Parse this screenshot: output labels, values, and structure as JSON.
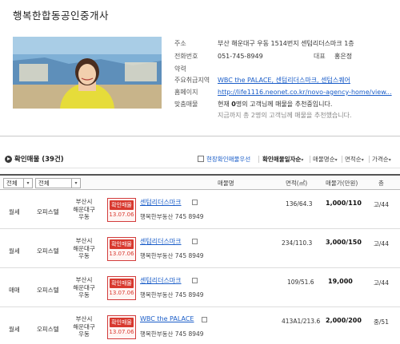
{
  "agency": {
    "name": "행복한합동공인중개사",
    "info": {
      "address_label": "주소",
      "address_value": "부산 해운대구 우동 1514번지 센텀리더스마크 1층",
      "phone_label": "전화번호",
      "phone_value": "051-745-8949",
      "rep_label": "대표",
      "rep_value": "홍은정",
      "brief_label": "약력",
      "region_label": "주요취급지역",
      "region_value": "WBC the PALACE, 센텀리더스마크, 센텀스퀘어",
      "homepage_label": "홈페이지",
      "homepage_value": "http://life1116.neonet.co.kr/novo-agency-home/view...",
      "custom_label": "맞춤매물",
      "custom_prefix": "현재 ",
      "custom_count": "0",
      "custom_suffix": "명의 고객님께 매물을 추천중입니다.",
      "custom_note": "지금까지 총 2명의 고객님께 매물을 추천했습니다."
    }
  },
  "section": {
    "title": "확인매물",
    "count": "(39건)"
  },
  "sort": {
    "items": [
      {
        "label": "현장확인매물우선"
      },
      {
        "label": "확인매물일자순"
      },
      {
        "label": "매물명순"
      },
      {
        "label": "면적순"
      },
      {
        "label": "가격순"
      }
    ],
    "arrow": "▾"
  },
  "list_header": {
    "filter1": "전체",
    "filter2": "전체",
    "col_name": "매물명",
    "col_area": "면적(㎡)",
    "col_price": "매물가(만원)",
    "col_floor": "층"
  },
  "stamp_label": "확인매물",
  "listings": [
    {
      "deal": "월세",
      "type": "오피스텔",
      "addr1": "부산시",
      "addr2": "해운대구",
      "addr3": "우동",
      "stamp_date": "13.07.06",
      "name": "센텀리더스마크",
      "agent": "행복한부동산 745 8949",
      "area": "136/64.3",
      "price": "1,000/110",
      "floor": "고/44"
    },
    {
      "deal": "월세",
      "type": "오피스텔",
      "addr1": "부산시",
      "addr2": "해운대구",
      "addr3": "우동",
      "stamp_date": "13.07.06",
      "name": "센텀리더스마크",
      "agent": "행복한부동산 745 8949",
      "area": "234/110.3",
      "price": "3,000/150",
      "floor": "고/44"
    },
    {
      "deal": "매매",
      "type": "오피스텔",
      "addr1": "부산시",
      "addr2": "해운대구",
      "addr3": "우동",
      "stamp_date": "13.07.06",
      "name": "센텀리더스마크",
      "agent": "행복한부동산 745 8949",
      "area": "109/51.6",
      "price": "19,000",
      "floor": "고/44"
    },
    {
      "deal": "월세",
      "type": "오피스텔",
      "addr1": "부산시",
      "addr2": "해운대구",
      "addr3": "우동",
      "stamp_date": "13.07.06",
      "name": "WBC the PALACE",
      "agent": "행복한부동산 745 8949",
      "area": "413A1/213.6",
      "price": "2,000/200",
      "floor": "중/51"
    }
  ]
}
